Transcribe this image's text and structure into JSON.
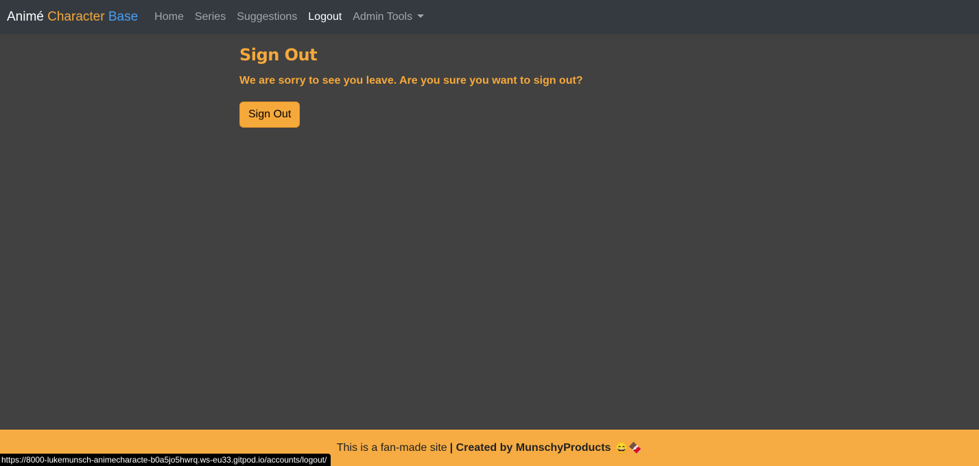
{
  "navbar": {
    "brand": {
      "part1": "Animé",
      "part2": "Character",
      "part3": "Base"
    },
    "links": [
      {
        "label": "Home"
      },
      {
        "label": "Series"
      },
      {
        "label": "Suggestions"
      },
      {
        "label": "Logout"
      },
      {
        "label": "Admin Tools"
      }
    ]
  },
  "main": {
    "title": "Sign Out",
    "message": "We are sorry to see you leave. Are you sure you want to sign out?",
    "button_label": "Sign Out"
  },
  "footer": {
    "text": "This is a fan-made site",
    "credit": "| Created by MunschyProducts",
    "emoji": "😄🍫"
  },
  "statusbar": {
    "url": "https://8000-lukemunsch-animecharacte-b0a5jo5hwrq.ws-eu33.gitpod.io/accounts/logout/"
  },
  "colors": {
    "accent": "#f6a93b",
    "brand_blue": "#4a9ff5",
    "navbar_bg": "#343a40",
    "page_bg": "#414141"
  }
}
